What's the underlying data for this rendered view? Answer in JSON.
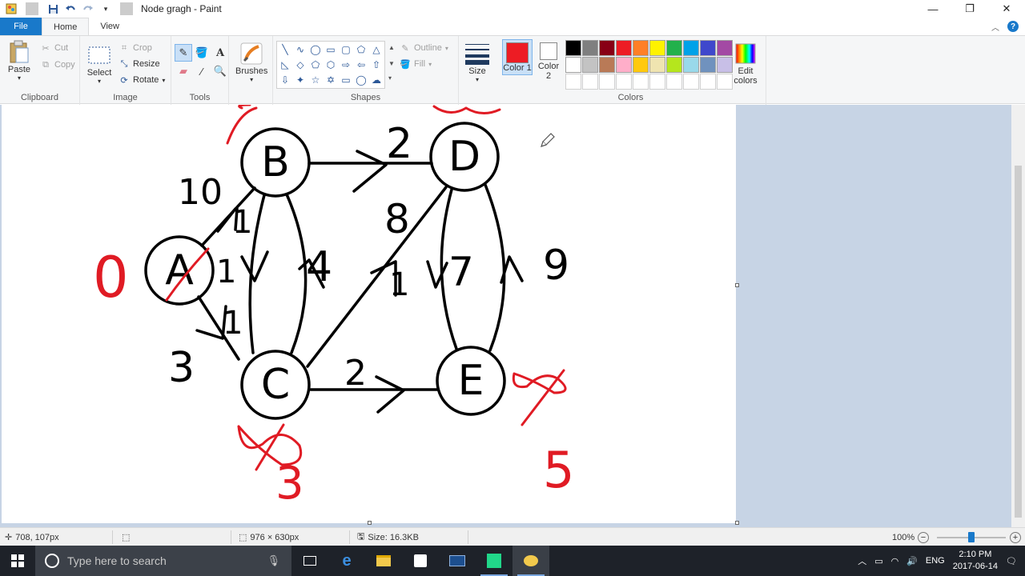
{
  "window": {
    "title": "Node gragh - Paint",
    "quick_access": [
      "save-icon",
      "undo-icon",
      "redo-icon",
      "customize-icon"
    ],
    "controls": [
      "minimize",
      "restore",
      "close"
    ]
  },
  "tabs": [
    {
      "label": "File"
    },
    {
      "label": "Home"
    },
    {
      "label": "View"
    }
  ],
  "ribbon": {
    "clipboard": {
      "group_label": "Clipboard",
      "paste": "Paste",
      "cut": "Cut",
      "copy": "Copy"
    },
    "image": {
      "group_label": "Image",
      "select": "Select",
      "crop": "Crop",
      "resize": "Resize",
      "rotate": "Rotate"
    },
    "tools": {
      "group_label": "Tools",
      "text_glyph": "A"
    },
    "brushes": {
      "label": "Brushes"
    },
    "shapes": {
      "group_label": "Shapes",
      "outline": "Outline",
      "fill": "Fill"
    },
    "size": {
      "label": "Size"
    },
    "colors": {
      "group_label": "Colors",
      "color1_label": "Color 1",
      "color2_label": "Color 2",
      "edit_colors": "Edit colors",
      "color1": "#ed1c24",
      "color2": "#ffffff",
      "palette": [
        "#000000",
        "#7f7f7f",
        "#880015",
        "#ed1c24",
        "#ff7f27",
        "#fff200",
        "#22b14c",
        "#00a2e8",
        "#3f48cc",
        "#a349a4",
        "#ffffff",
        "#c3c3c3",
        "#b97a57",
        "#ffaec9",
        "#ffc90e",
        "#efe4b0",
        "#b5e61d",
        "#99d9ea",
        "#7092be",
        "#c8bfe7",
        "#ffffff",
        "#ffffff",
        "#ffffff",
        "#ffffff",
        "#ffffff",
        "#ffffff",
        "#ffffff",
        "#ffffff",
        "#ffffff",
        "#ffffff"
      ]
    }
  },
  "graph": {
    "nodes": [
      "A",
      "B",
      "C",
      "D",
      "E"
    ],
    "edge_labels": [
      "10",
      "3",
      "4",
      "2",
      "8",
      "2",
      "7",
      "9",
      "1",
      "1",
      "1",
      "1"
    ],
    "distance_labels": [
      "0",
      "3",
      "5"
    ]
  },
  "statusbar": {
    "cursor_pos": "708, 107px",
    "canvas_size": "976 × 630px",
    "file_size": "Size: 16.3KB",
    "zoom": "100%",
    "zoom_level": 0.5
  },
  "taskbar": {
    "search_placeholder": "Type here to search",
    "language": "ENG",
    "time": "2:10 PM",
    "date": "2017-06-14"
  }
}
